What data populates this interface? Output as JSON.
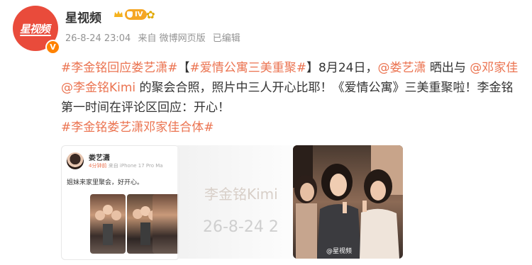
{
  "account": {
    "name": "星视频",
    "level_badge": "IV",
    "avatar_logo": "星视频"
  },
  "meta": {
    "timestamp": "26-8-24 23:04",
    "source": "来自 微博网页版",
    "edited": "已编辑"
  },
  "post": {
    "segments": [
      {
        "text": "#李金铭回应娄艺潇#",
        "type": "tag"
      },
      {
        "text": "【",
        "type": "text"
      },
      {
        "text": "#爱情公寓三美重聚#",
        "type": "tag"
      },
      {
        "text": "】8月24日，",
        "type": "text"
      },
      {
        "text": "@娄艺潇",
        "type": "tag"
      },
      {
        "text": " 晒出与 ",
        "type": "text"
      },
      {
        "text": "@邓家佳",
        "type": "tag"
      },
      {
        "text": " ",
        "type": "text"
      },
      {
        "text": "@李金铭Kimi",
        "type": "tag"
      },
      {
        "text": " 的聚会合照，照片中三人开心比耶！《爱情公寓》三美重聚啦！李金铭第一时间在评论区回应：开心！",
        "type": "text"
      },
      {
        "text": "#李金铭娄艺潇邓家佳合体#",
        "type": "tag"
      }
    ]
  },
  "embedded_card": {
    "name": "娄艺潇",
    "time": "4分钟前",
    "device": "来自 iPhone 17 Pro Ma",
    "text": "姐妹来家里聚会，好开心。"
  },
  "background_overlay": {
    "name": "李金铭Kimi",
    "date": "26-8-24 2"
  },
  "photo": {
    "watermark": "@星视频"
  },
  "colors": {
    "accent": "#eb7350",
    "avatar_red": "#e94b3b",
    "vip_orange": "#ff8200",
    "meta_gray": "#939393"
  }
}
